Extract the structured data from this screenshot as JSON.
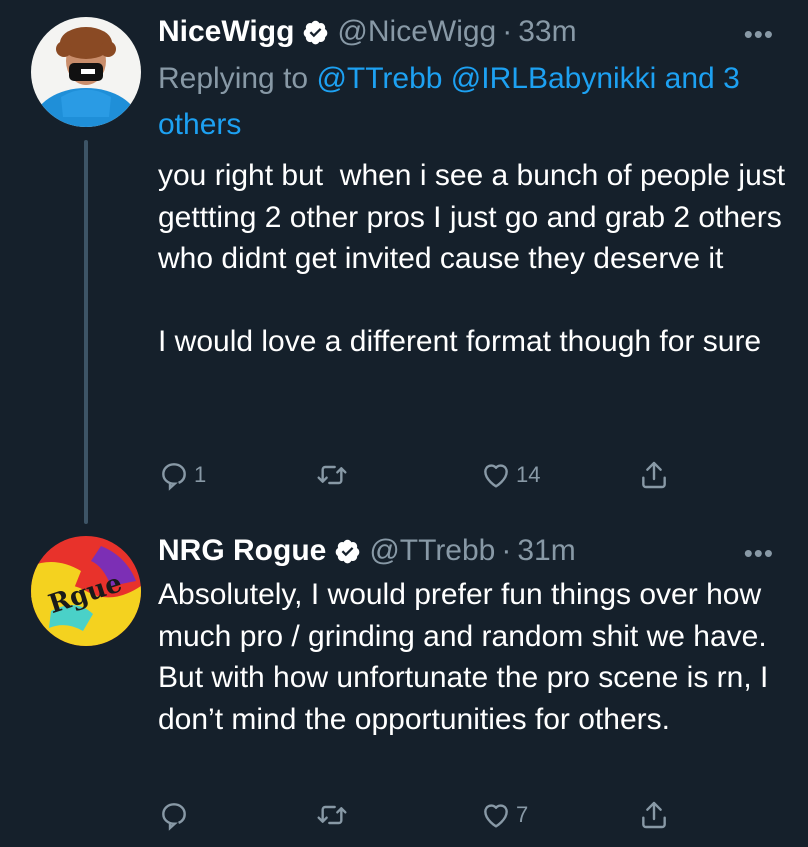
{
  "tweets": [
    {
      "name": "NiceWigg",
      "handle": "@NiceWigg",
      "separator": "·",
      "time": "33m",
      "replying_prefix": "Replying to ",
      "replying_mentions": "@TTrebb @IRLBabynikki and 3 others",
      "text": "you right but  when i see a bunch of people just gettting 2 other pros I just go and grab 2 others who didnt get invited cause they deserve it\n\nI would love a different format though for sure",
      "reply_count": "1",
      "retweet_count": "",
      "like_count": "14",
      "more_label": "•••"
    },
    {
      "name": "NRG Rogue",
      "handle": "@TTrebb",
      "separator": "·",
      "time": "31m",
      "text": "Absolutely, I would prefer fun things over how much pro / grinding and random shit we have. But with how unfortunate the pro scene is rn, I don’t mind the opportunities for others.",
      "reply_count": "",
      "retweet_count": "",
      "like_count": "7",
      "more_label": "•••"
    }
  ],
  "colors": {
    "background": "#15202b",
    "secondary_text": "#8899a6",
    "link": "#1da1f2",
    "thread_line": "#3d5466"
  },
  "icons": [
    "verified-badge-icon",
    "reply-icon",
    "retweet-icon",
    "like-icon",
    "share-icon",
    "more-icon"
  ]
}
